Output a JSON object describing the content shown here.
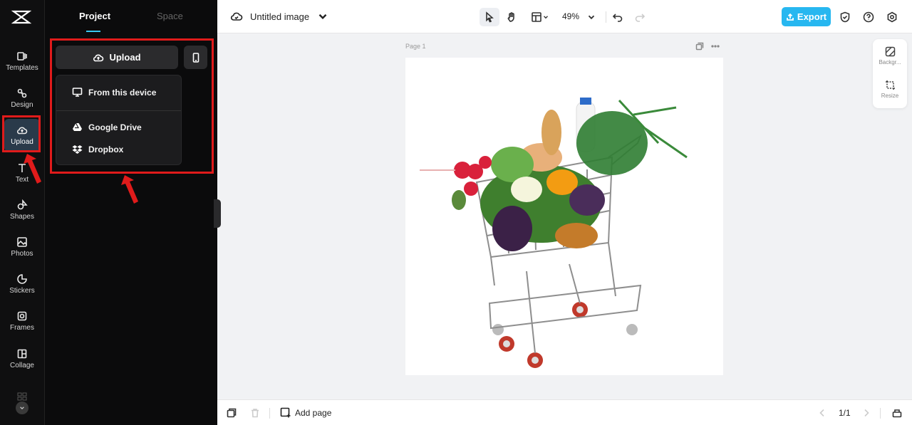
{
  "app": {
    "document_title": "Untitled image"
  },
  "rail": {
    "items": [
      {
        "label": "Templates",
        "icon": "templates-icon"
      },
      {
        "label": "Design",
        "icon": "design-icon"
      },
      {
        "label": "Upload",
        "icon": "upload-cloud-icon",
        "active": true
      },
      {
        "label": "Text",
        "icon": "text-icon"
      },
      {
        "label": "Shapes",
        "icon": "shapes-icon"
      },
      {
        "label": "Photos",
        "icon": "photos-icon"
      },
      {
        "label": "Stickers",
        "icon": "stickers-icon"
      },
      {
        "label": "Frames",
        "icon": "frames-icon"
      },
      {
        "label": "Collage",
        "icon": "collage-icon"
      }
    ]
  },
  "panel": {
    "tabs": [
      {
        "label": "Project",
        "active": true
      },
      {
        "label": "Space"
      }
    ],
    "upload_label": "Upload",
    "dropdown": {
      "items": [
        {
          "label": "From this device",
          "icon": "monitor-icon"
        },
        {
          "label": "Google Drive",
          "icon": "google-drive-icon"
        },
        {
          "label": "Dropbox",
          "icon": "dropbox-icon"
        }
      ]
    }
  },
  "toolbar": {
    "zoom": "49%",
    "export_label": "Export"
  },
  "canvas": {
    "page_label": "Page 1"
  },
  "right_panel": {
    "background_label": "Backgr...",
    "resize_label": "Resize"
  },
  "bottom": {
    "add_page_label": "Add page",
    "page_indicator": "1/1"
  },
  "colors": {
    "accent": "#27b7f0",
    "highlight": "#e01b1b",
    "rail_bg": "#0f0f10"
  }
}
